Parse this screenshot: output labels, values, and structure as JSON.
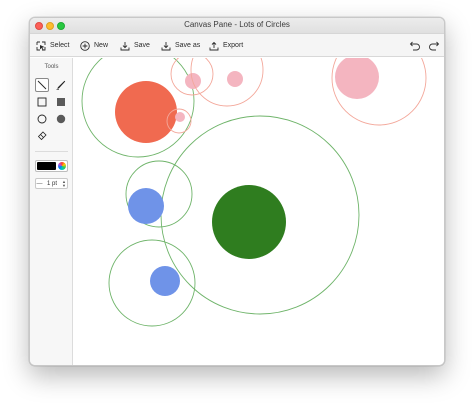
{
  "window": {
    "title": "Canvas Pane - Lots of Circles"
  },
  "toolbar": {
    "select_label": "Select",
    "new_label": "New",
    "save_label": "Save",
    "save_as_label": "Save as",
    "export_label": "Export"
  },
  "sidebar": {
    "tools_label": "Tools",
    "line_width": "1 pt",
    "minus_label": "—",
    "selected_color": "#000000"
  },
  "circles": [
    {
      "role": "outline",
      "stroke": "#6fb46a"
    },
    {
      "role": "fill",
      "fill": "#f06a50"
    },
    {
      "role": "outline",
      "stroke": "#f3a79a"
    },
    {
      "role": "fill",
      "fill": "#f4b5c0"
    },
    {
      "role": "outline",
      "stroke": "#f3a79a"
    },
    {
      "role": "fill",
      "fill": "#f4b5c0"
    },
    {
      "role": "outline",
      "stroke": "#f3a79a"
    },
    {
      "role": "fill",
      "fill": "#f4b5c0"
    },
    {
      "role": "outline",
      "stroke": "#f3a79a"
    },
    {
      "role": "fill",
      "fill": "#f4b5c0"
    },
    {
      "role": "outline",
      "stroke": "#6fb46a"
    },
    {
      "role": "fill",
      "fill": "#2f7d1f"
    },
    {
      "role": "outline",
      "stroke": "#6fb46a"
    },
    {
      "role": "fill",
      "fill": "#6f93e8"
    },
    {
      "role": "outline",
      "stroke": "#6fb46a"
    },
    {
      "role": "fill",
      "fill": "#6f93e8"
    }
  ]
}
